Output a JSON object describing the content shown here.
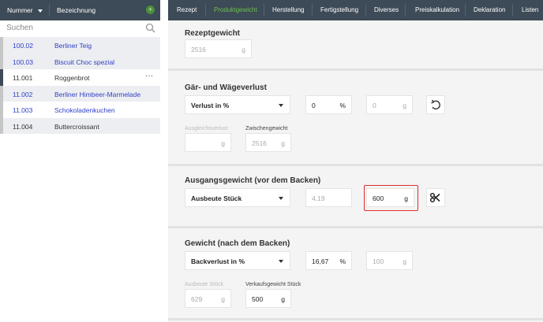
{
  "left_panel": {
    "header": {
      "nummer": "Nummer",
      "bezeichnung": "Bezeichnung",
      "add": "+"
    },
    "search": {
      "placeholder": "Suchen"
    },
    "items": [
      {
        "num": "100.02",
        "name": "Berliner Teig"
      },
      {
        "num": "100.03",
        "name": "Biscuit Choc spezial"
      },
      {
        "num": "11.001",
        "name": "Roggenbrot",
        "menu": "···"
      },
      {
        "num": "11.002",
        "name": "Berliner Himbeer-Marmelade"
      },
      {
        "num": "11.003",
        "name": "Schokoladenkuchen"
      },
      {
        "num": "11.004",
        "name": "Buttercroissant"
      }
    ]
  },
  "tabs": [
    "Rezept",
    "Produktgewicht",
    "Herstellung",
    "Fertigstellung",
    "Diverses",
    "Preiskalkulation",
    "Deklaration",
    "Listen"
  ],
  "active_tab": "Produktgewicht",
  "rezeptgewicht": {
    "title": "Rezeptgewicht",
    "value": "2516",
    "unit": "g"
  },
  "gaer": {
    "title": "Gär- und Wägeverlust",
    "select": "Verlust in %",
    "percent_value": "0",
    "percent_unit": "%",
    "gram_value": "0",
    "gram_unit": "g",
    "ausgleich_label": "Ausgleichsverlust",
    "ausgleich_value": "",
    "ausgleich_unit": "g",
    "zwischen_label": "Zwischengewicht",
    "zwischen_value": "2516",
    "zwischen_unit": "g"
  },
  "ausgang": {
    "title": "Ausgangsgewicht (vor dem Backen)",
    "select": "Ausbeute Stück",
    "factor_value": "4,19",
    "weight_value": "600",
    "weight_unit": "g"
  },
  "gewicht": {
    "title": "Gewicht (nach dem Backen)",
    "select": "Backverlust in %",
    "percent_value": "16,67",
    "percent_unit": "%",
    "gram_value": "100",
    "gram_unit": "g",
    "ausbeute_label": "Ausbeute Stück",
    "ausbeute_value": "629",
    "ausbeute_unit": "g",
    "verkauf_label": "Verkaufsgewicht Stück",
    "verkauf_value": "500",
    "verkauf_unit": "g"
  },
  "colors": {
    "header_bg": "#3d4a57",
    "active_tab": "#6cc04a",
    "link_blue": "#2f3fc7",
    "highlight_red": "#e02c2c"
  }
}
